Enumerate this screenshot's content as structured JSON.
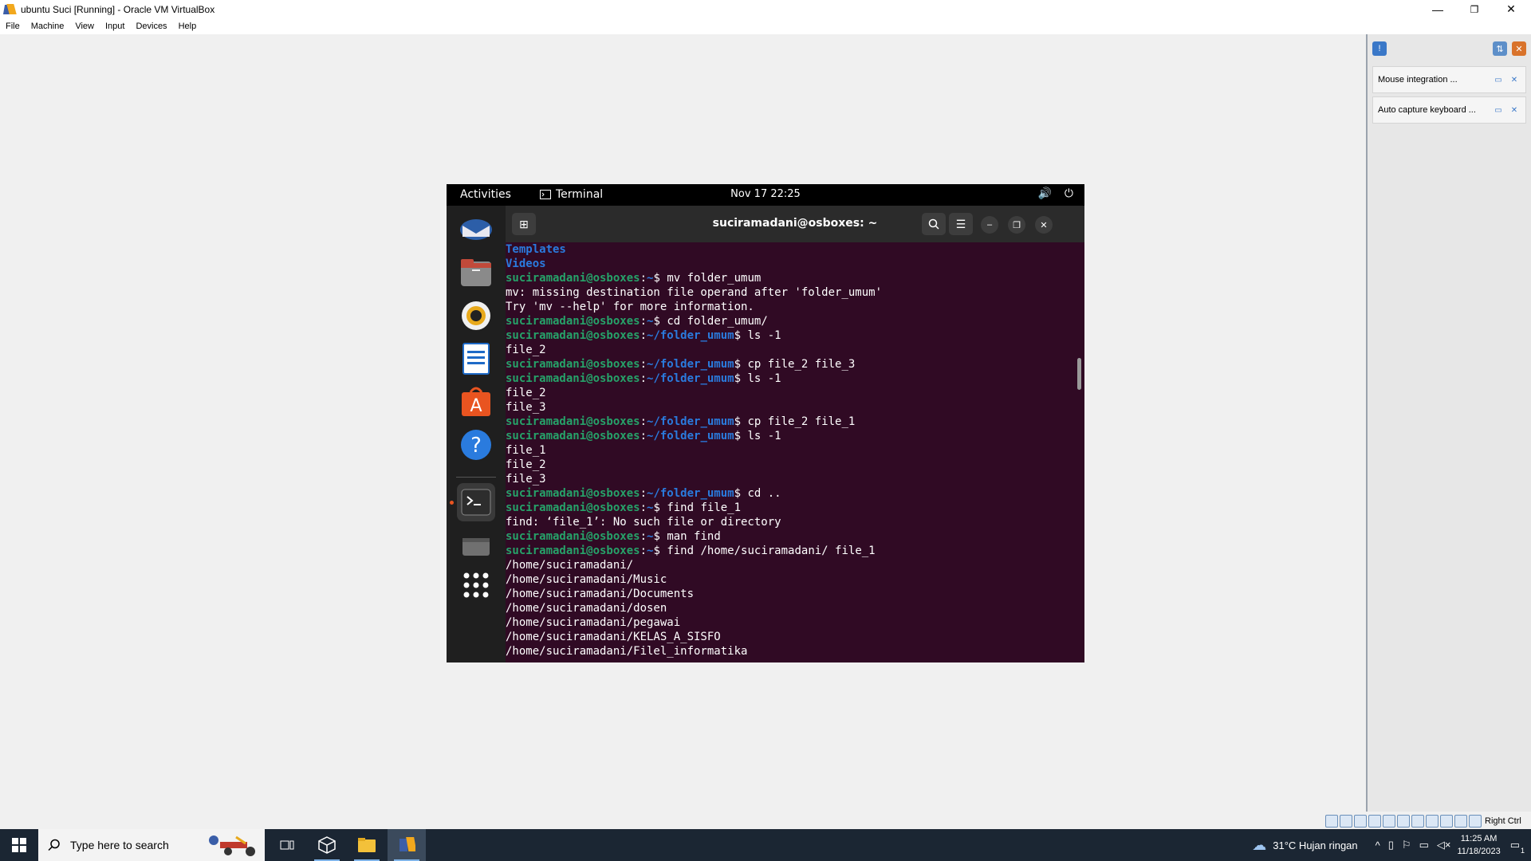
{
  "window": {
    "title": "ubuntu Suci [Running] - Oracle VM VirtualBox",
    "minimize": "—",
    "restore": "❐",
    "close": "✕"
  },
  "menu": [
    "File",
    "Machine",
    "View",
    "Input",
    "Devices",
    "Help"
  ],
  "notifications": [
    {
      "text": "Mouse integration ..."
    },
    {
      "text": "Auto capture keyboard ..."
    }
  ],
  "statusbar": {
    "host_key": "Right Ctrl"
  },
  "guest": {
    "topbar": {
      "activities": "Activities",
      "app_label": "Terminal",
      "clock": "Nov 17  22:25"
    },
    "terminal": {
      "title": "suciramadani@osboxes: ~",
      "user": "suciramadani@osboxes",
      "lines": [
        {
          "type": "dir",
          "text": "Templates"
        },
        {
          "type": "dir",
          "text": "Videos"
        },
        {
          "type": "prompt",
          "path": "~",
          "cmd": " mv folder_umum"
        },
        {
          "type": "out",
          "text": "mv: missing destination file operand after 'folder_umum'"
        },
        {
          "type": "out",
          "text": "Try 'mv --help' for more information."
        },
        {
          "type": "prompt",
          "path": "~",
          "cmd": " cd folder_umum/"
        },
        {
          "type": "prompt",
          "path": "~/folder_umum",
          "cmd": " ls -1"
        },
        {
          "type": "out",
          "text": "file_2"
        },
        {
          "type": "prompt",
          "path": "~/folder_umum",
          "cmd": " cp file_2 file_3"
        },
        {
          "type": "prompt",
          "path": "~/folder_umum",
          "cmd": " ls -1"
        },
        {
          "type": "out",
          "text": "file_2"
        },
        {
          "type": "out",
          "text": "file_3"
        },
        {
          "type": "prompt",
          "path": "~/folder_umum",
          "cmd": " cp file_2 file_1"
        },
        {
          "type": "prompt",
          "path": "~/folder_umum",
          "cmd": " ls -1"
        },
        {
          "type": "out",
          "text": "file_1"
        },
        {
          "type": "out",
          "text": "file_2"
        },
        {
          "type": "out",
          "text": "file_3"
        },
        {
          "type": "prompt",
          "path": "~/folder_umum",
          "cmd": " cd .."
        },
        {
          "type": "prompt",
          "path": "~",
          "cmd": " find file_1"
        },
        {
          "type": "out",
          "text": "find: ‘file_1’: No such file or directory"
        },
        {
          "type": "prompt",
          "path": "~",
          "cmd": " man find"
        },
        {
          "type": "prompt",
          "path": "~",
          "cmd": " find /home/suciramadani/ file_1"
        },
        {
          "type": "out",
          "text": "/home/suciramadani/"
        },
        {
          "type": "out",
          "text": "/home/suciramadani/Music"
        },
        {
          "type": "out",
          "text": "/home/suciramadani/Documents"
        },
        {
          "type": "out",
          "text": "/home/suciramadani/dosen"
        },
        {
          "type": "out",
          "text": "/home/suciramadani/pegawai"
        },
        {
          "type": "out",
          "text": "/home/suciramadani/KELAS_A_SISFO"
        },
        {
          "type": "out",
          "text": "/home/suciramadani/Filel_informatika"
        }
      ]
    }
  },
  "taskbar": {
    "search_placeholder": "Type here to search",
    "weather": "31°C  Hujan ringan",
    "time": "11:25 AM",
    "date": "11/18/2023",
    "notif_count": "1"
  }
}
